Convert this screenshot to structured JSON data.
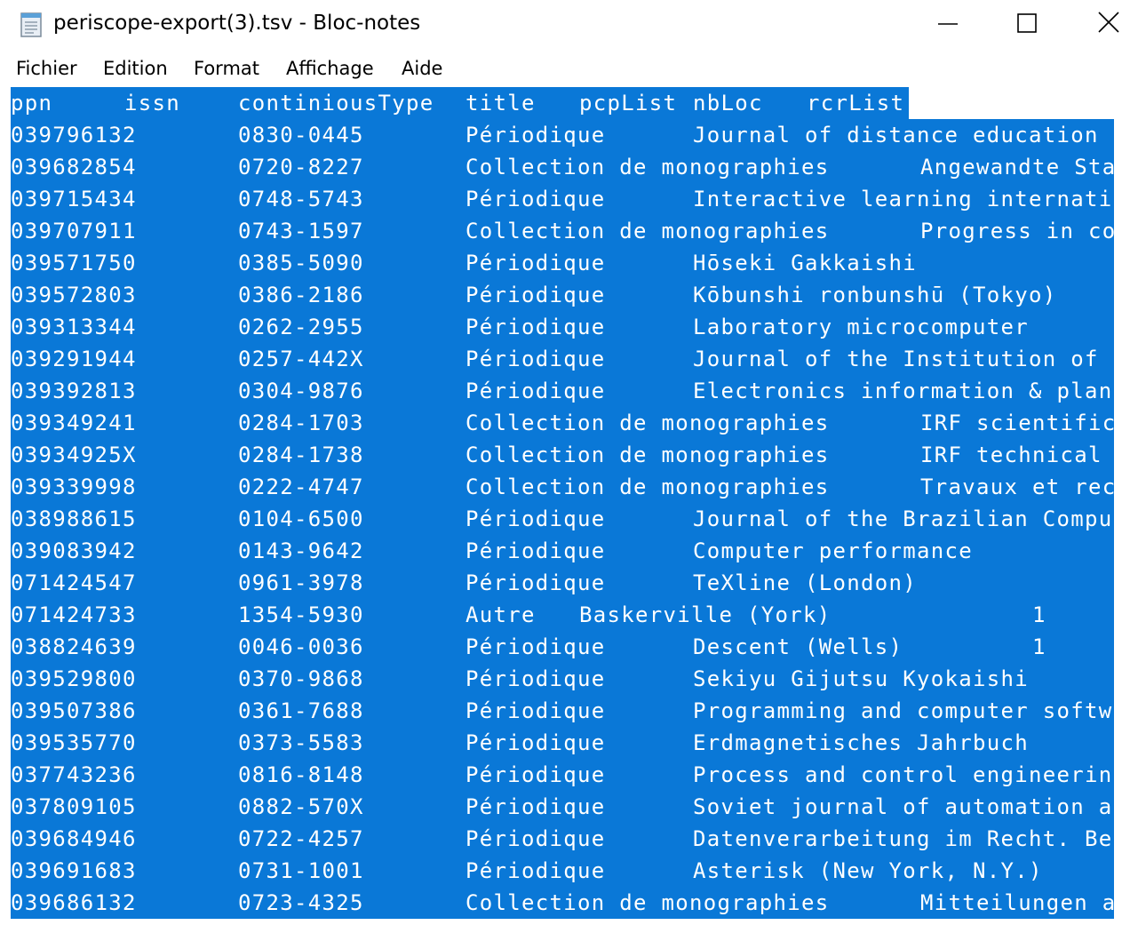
{
  "window": {
    "title": "periscope-export(3).tsv - Bloc-notes",
    "icon": "notepad-icon",
    "controls": [
      "minimize-icon",
      "maximize-icon",
      "close-icon"
    ]
  },
  "menu": {
    "items": [
      "Fichier",
      "Edition",
      "Format",
      "Affichage",
      "Aide"
    ]
  },
  "colors": {
    "selection": "#0a78d7",
    "selected_text": "#ffffff"
  },
  "editor": {
    "header": {
      "ppn": "ppn",
      "issn": "issn",
      "type": "continiousType",
      "title": "title",
      "pcp": "pcpList",
      "nbloc": "nbLoc",
      "rcr": "rcrList"
    },
    "rows": [
      {
        "ppn": "039796132",
        "issn": "0830-0445",
        "type": "Périodique",
        "title": "Journal of distance education",
        "nbloc": ""
      },
      {
        "ppn": "039682854",
        "issn": "0720-8227",
        "type": "Collection de monographies",
        "title": "Angewandte Sta",
        "nbloc": ""
      },
      {
        "ppn": "039715434",
        "issn": "0748-5743",
        "type": "Périodique",
        "title": "Interactive learning internati",
        "nbloc": ""
      },
      {
        "ppn": "039707911",
        "issn": "0743-1597",
        "type": "Collection de monographies",
        "title": "Progress in co",
        "nbloc": ""
      },
      {
        "ppn": "039571750",
        "issn": "0385-5090",
        "type": "Périodique",
        "title": "Hōseki Gakkaishi",
        "nbloc": ""
      },
      {
        "ppn": "039572803",
        "issn": "0386-2186",
        "type": "Périodique",
        "title": "Kōbunshi ronbunshū (Tokyo)",
        "nbloc": ""
      },
      {
        "ppn": "039313344",
        "issn": "0262-2955",
        "type": "Périodique",
        "title": "Laboratory microcomputer",
        "nbloc": ""
      },
      {
        "ppn": "039291944",
        "issn": "0257-442X",
        "type": "Périodique",
        "title": "Journal of the Institution of",
        "nbloc": ""
      },
      {
        "ppn": "039392813",
        "issn": "0304-9876",
        "type": "Périodique",
        "title": "Electronics information & plan",
        "nbloc": ""
      },
      {
        "ppn": "039349241",
        "issn": "0284-1703",
        "type": "Collection de monographies",
        "title": "IRF scientific",
        "nbloc": ""
      },
      {
        "ppn": "03934925X",
        "issn": "0284-1738",
        "type": "Collection de monographies",
        "title": "IRF technical",
        "nbloc": ""
      },
      {
        "ppn": "039339998",
        "issn": "0222-4747",
        "type": "Collection de monographies",
        "title": "Travaux et rec",
        "nbloc": ""
      },
      {
        "ppn": "038988615",
        "issn": "0104-6500",
        "type": "Périodique",
        "title": "Journal of the Brazilian Compu",
        "nbloc": ""
      },
      {
        "ppn": "039083942",
        "issn": "0143-9642",
        "type": "Périodique",
        "title": "Computer performance",
        "nbloc": ""
      },
      {
        "ppn": "071424547",
        "issn": "0961-3978",
        "type": "Périodique",
        "title": "TeXline (London)",
        "nbloc": ""
      },
      {
        "ppn": "071424733",
        "issn": "1354-5930",
        "type": "Autre",
        "title": "Baskerville (York)",
        "nbloc": "1"
      },
      {
        "ppn": "038824639",
        "issn": "0046-0036",
        "type": "Périodique",
        "title": "Descent (Wells)",
        "nbloc": "1"
      },
      {
        "ppn": "039529800",
        "issn": "0370-9868",
        "type": "Périodique",
        "title": "Sekiyu Gijutsu Kyokaishi",
        "nbloc": ""
      },
      {
        "ppn": "039507386",
        "issn": "0361-7688",
        "type": "Périodique",
        "title": "Programming and computer softw",
        "nbloc": ""
      },
      {
        "ppn": "039535770",
        "issn": "0373-5583",
        "type": "Périodique",
        "title": "Erdmagnetisches Jahrbuch",
        "nbloc": ""
      },
      {
        "ppn": "037743236",
        "issn": "0816-8148",
        "type": "Périodique",
        "title": "Process and control engineerin",
        "nbloc": ""
      },
      {
        "ppn": "037809105",
        "issn": "0882-570X",
        "type": "Périodique",
        "title": "Soviet journal of automation a",
        "nbloc": ""
      },
      {
        "ppn": "039684946",
        "issn": "0722-4257",
        "type": "Périodique",
        "title": "Datenverarbeitung im Recht. Be",
        "nbloc": ""
      },
      {
        "ppn": "039691683",
        "issn": "0731-1001",
        "type": "Périodique",
        "title": "Asterisk (New York, N.Y.)",
        "nbloc": ""
      },
      {
        "ppn": "039686132",
        "issn": "0723-4325",
        "type": "Collection de monographies",
        "title": "Mitteilungen a",
        "nbloc": ""
      }
    ]
  }
}
